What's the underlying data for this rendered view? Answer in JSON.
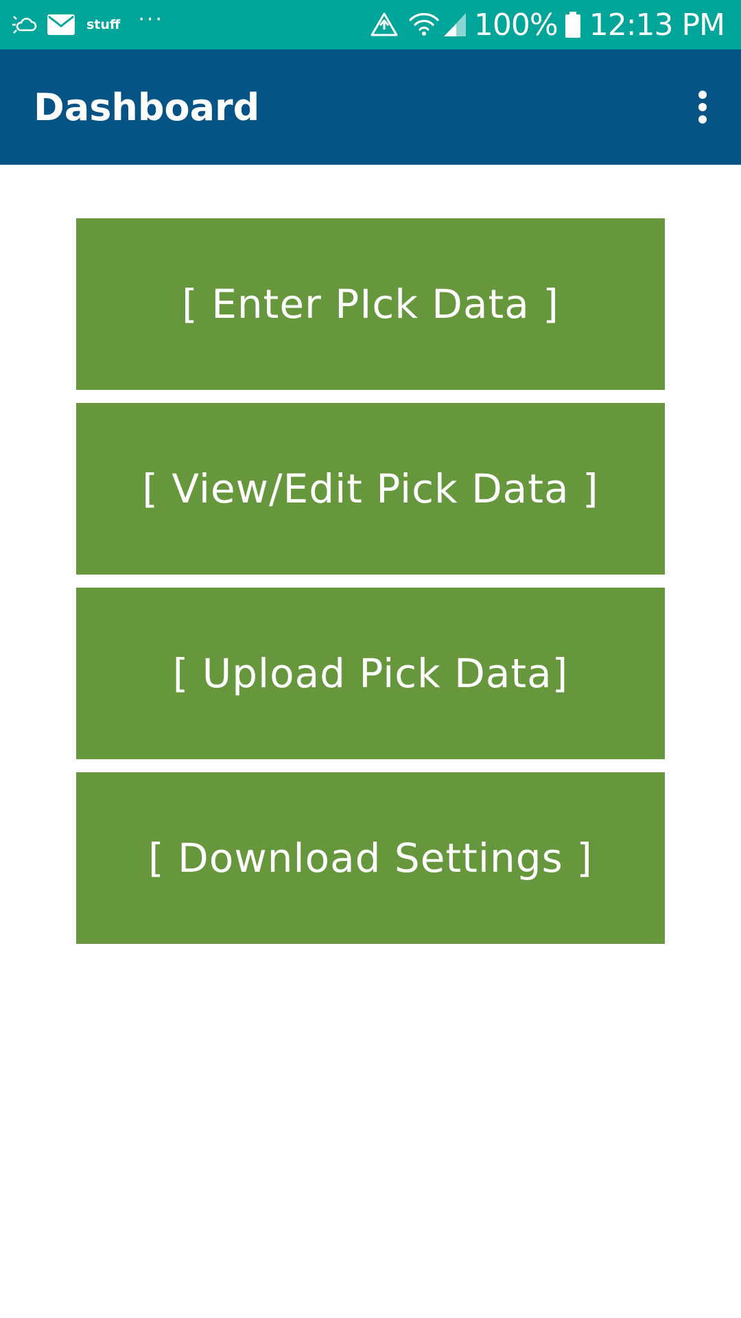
{
  "status_bar": {
    "notification_icons": [
      "weather-icon",
      "email-icon"
    ],
    "carrier_label": "stuff",
    "more_indicator": "···",
    "battery_percent": "100%",
    "time": "12:13 PM"
  },
  "app_bar": {
    "title": "Dashboard",
    "menu_icon": "overflow-menu-icon"
  },
  "actions": [
    {
      "label": "[ Enter PIck Data ]"
    },
    {
      "label": "[ View/Edit Pick Data ]"
    },
    {
      "label": "[ Upload Pick Data]"
    },
    {
      "label": "[ Download Settings ]"
    }
  ],
  "colors": {
    "status_bar": "#00a59a",
    "app_bar": "#055485",
    "button": "#67973d",
    "background": "#ffffff",
    "text": "#ffffff"
  }
}
